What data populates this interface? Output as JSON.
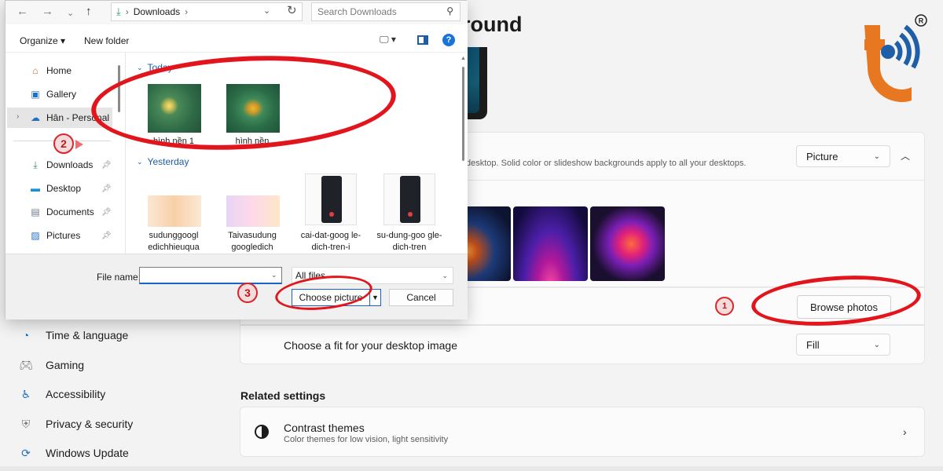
{
  "settings": {
    "page_title": "round",
    "background_description": "desktop. Solid color or slideshow backgrounds apply to all your desktops.",
    "background_type_value": "Picture",
    "browse_label": "Browse photos",
    "fit_label": "Choose a fit for your desktop image",
    "fit_value": "Fill",
    "related_heading": "Related settings",
    "contrast_title": "Contrast themes",
    "contrast_subtitle": "Color themes for low vision, light sensitivity",
    "nav": [
      {
        "label": "Time & language",
        "icon": "clock-globe-icon"
      },
      {
        "label": "Gaming",
        "icon": "gamepad-icon"
      },
      {
        "label": "Accessibility",
        "icon": "accessibility-icon"
      },
      {
        "label": "Privacy & security",
        "icon": "shield-icon"
      },
      {
        "label": "Windows Update",
        "icon": "update-icon"
      }
    ]
  },
  "logo": {
    "registered_mark": "R"
  },
  "markers": {
    "m1": "1",
    "m2": "2",
    "m3": "3"
  },
  "dialog": {
    "address_path": "Downloads",
    "search_placeholder": "Search Downloads",
    "toolbar": {
      "organize": "Organize",
      "new_folder": "New folder"
    },
    "sidebar": [
      {
        "label": "Home"
      },
      {
        "label": "Gallery"
      },
      {
        "label": "Hân - Personal"
      },
      {
        "label": "Downloads"
      },
      {
        "label": "Desktop"
      },
      {
        "label": "Documents"
      },
      {
        "label": "Pictures"
      }
    ],
    "groups": {
      "today": "Today",
      "yesterday": "Yesterday"
    },
    "files": [
      {
        "name": "hình nền 1"
      },
      {
        "name": "hình nền"
      },
      {
        "name": "sudunggoogl edichhieuqua"
      },
      {
        "name": "Taivasudung googledich"
      },
      {
        "name": "cai-dat-goog le-dich-tren-i"
      },
      {
        "name": "su-dung-goo gle-dich-tren"
      }
    ],
    "file_name_label": "File name:",
    "file_name_value": "",
    "file_type_value": "All files",
    "choose_label": "Choose picture",
    "cancel_label": "Cancel"
  },
  "colors": {
    "accent": "#1a63c6",
    "annotation": "#e3151c",
    "logo_orange": "#e87722",
    "logo_blue": "#1f5fa8"
  }
}
